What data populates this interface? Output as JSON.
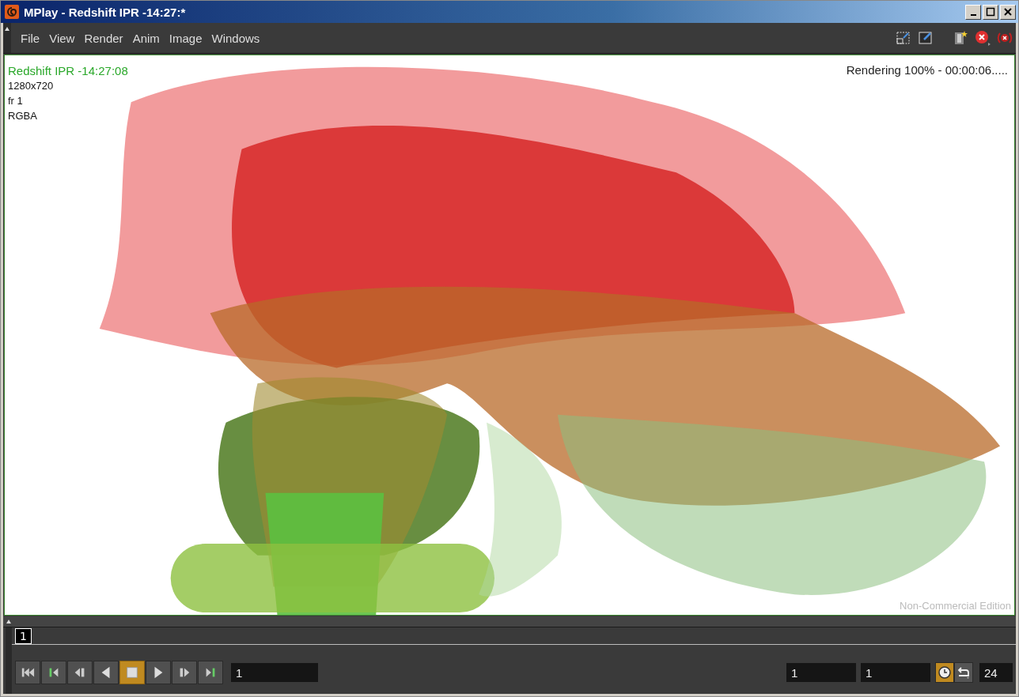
{
  "window": {
    "title": "MPlay - Redshift IPR -14:27:*"
  },
  "menu": [
    "File",
    "View",
    "Render",
    "Anim",
    "Image",
    "Windows"
  ],
  "toolbar": [
    {
      "kind": "region"
    },
    {
      "kind": "region-edit"
    },
    {
      "kind": "snapshot"
    },
    {
      "kind": "stop"
    },
    {
      "kind": "stop-all"
    }
  ],
  "viewport": {
    "kind": "picture",
    "info": [
      {
        "text": "Redshift IPR -14:27:08",
        "kind": "title"
      },
      {
        "text": "1280x720",
        "kind": "plain"
      },
      {
        "text": "fr 1",
        "kind": "plain"
      },
      {
        "text": "RGBA",
        "kind": "plain"
      }
    ],
    "status": "Rendering 100% - 00:00:06.....",
    "watermark": "Non-Commercial Edition"
  },
  "timeline": {
    "frame_marker": "1"
  },
  "transport": [
    {
      "kind": "first",
      "selected": false
    },
    {
      "kind": "start",
      "selected": false
    },
    {
      "kind": "step-back",
      "selected": false
    },
    {
      "kind": "play-back",
      "selected": false
    },
    {
      "kind": "stop",
      "selected": true
    },
    {
      "kind": "play",
      "selected": false
    },
    {
      "kind": "step-forward",
      "selected": false
    },
    {
      "kind": "end",
      "selected": false
    }
  ],
  "current_frame": "1",
  "range_start": "1",
  "range_end": "1",
  "realtime": {
    "selected": true
  },
  "loop": {
    "selected": false
  },
  "fps": "24"
}
